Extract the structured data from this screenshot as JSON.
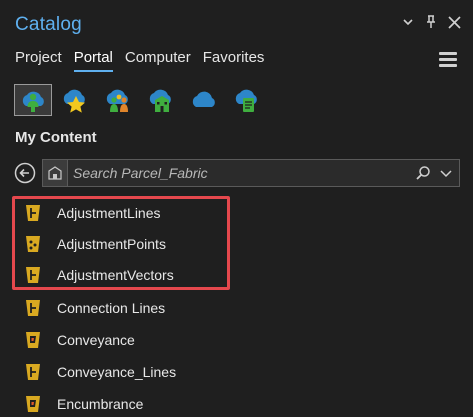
{
  "window": {
    "title": "Catalog",
    "buttons": [
      "chevron-down-icon",
      "pin-icon",
      "close-icon"
    ]
  },
  "tabs": [
    {
      "label": "Project",
      "active": false
    },
    {
      "label": "Portal",
      "active": true
    },
    {
      "label": "Computer",
      "active": false
    },
    {
      "label": "Favorites",
      "active": false
    }
  ],
  "portal_icons": [
    "my-content-icon",
    "favorites-icon",
    "groups-icon",
    "organization-icon",
    "arcgis-online-icon",
    "living-atlas-icon"
  ],
  "section": {
    "title": "My Content"
  },
  "search": {
    "placeholder": "Search Parcel_Fabric",
    "value": ""
  },
  "items": [
    {
      "label": "AdjustmentLines",
      "icon": "line-feature-layer-icon"
    },
    {
      "label": "AdjustmentPoints",
      "icon": "point-feature-layer-icon"
    },
    {
      "label": "AdjustmentVectors",
      "icon": "line-feature-layer-icon"
    },
    {
      "label": "Connection Lines",
      "icon": "line-feature-layer-icon"
    },
    {
      "label": "Conveyance",
      "icon": "polygon-feature-layer-icon"
    },
    {
      "label": "Conveyance_Lines",
      "icon": "line-feature-layer-icon"
    },
    {
      "label": "Encumbrance",
      "icon": "polygon-feature-layer-icon"
    }
  ],
  "colors": {
    "accent": "#5fb0ef",
    "background": "#1f1f1f",
    "highlight_border": "#e5484d",
    "layer_icon": "#d9a921"
  }
}
